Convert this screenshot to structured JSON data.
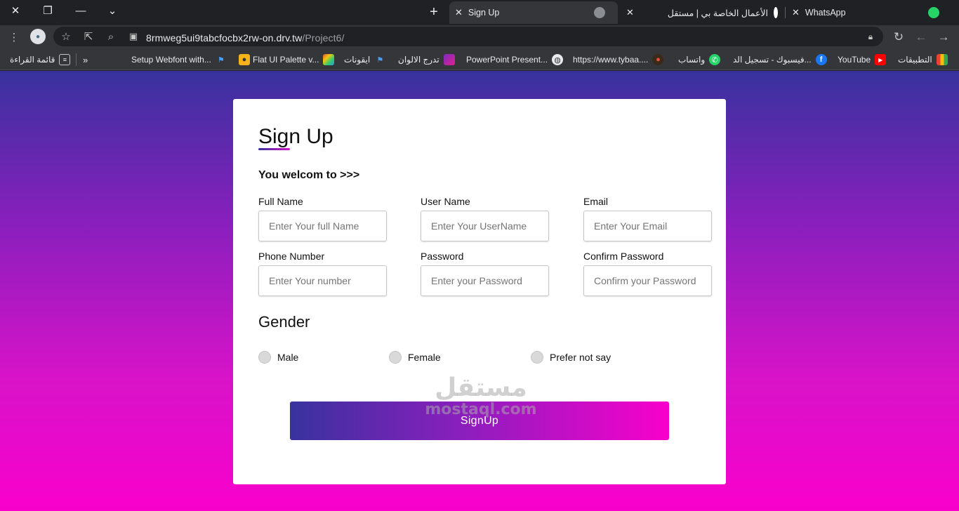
{
  "browser": {
    "tabs": [
      {
        "title": "Sign Up",
        "active": true
      },
      {
        "title": "الأعمال الخاصة بي | مستقل",
        "active": false
      },
      {
        "title": "WhatsApp",
        "active": false
      }
    ],
    "url_host": "8rmweg5ui9tabcfocbx2rw-on.drv.tw",
    "url_path": "/Project6/",
    "reading_list": "قائمة القراءة",
    "bookmarks": [
      {
        "label": "Setup Webfont with...",
        "icon": "flag-icon"
      },
      {
        "label": "Flat UI Palette v...",
        "icon": "palette-icon"
      },
      {
        "label": "ايقونات",
        "icon": "flag-icon"
      },
      {
        "label": "تدرج الالوان",
        "icon": "gradient-icon"
      },
      {
        "label": "PowerPoint Present...",
        "icon": "globe-icon"
      },
      {
        "label": "https://www.tybaa....",
        "icon": "site-icon"
      },
      {
        "label": "واتساب",
        "icon": "whatsapp-icon"
      },
      {
        "label": "فيسبوك - تسجيل الد...",
        "icon": "facebook-icon"
      },
      {
        "label": "YouTube",
        "icon": "youtube-icon"
      },
      {
        "label": "التطبيقات",
        "icon": "apps-grid-icon"
      }
    ]
  },
  "form": {
    "title": "Sign Up",
    "subtitle": "You welcom to >>>",
    "fields": [
      {
        "label": "Full Name",
        "placeholder": "Enter Your full Name"
      },
      {
        "label": "User Name",
        "placeholder": "Enter Your UserName"
      },
      {
        "label": "Email",
        "placeholder": "Enter Your Email"
      },
      {
        "label": "Phone Number",
        "placeholder": "Enter Your number"
      },
      {
        "label": "Password",
        "placeholder": "Enter your Password"
      },
      {
        "label": "Confirm Password",
        "placeholder": "Confirm your Password"
      }
    ],
    "gender_title": "Gender",
    "gender_options": [
      "Male",
      "Female",
      "Prefer not say"
    ],
    "submit_label": "SignUp"
  },
  "watermark": {
    "arabic": "مستقل",
    "latin": "mostaql.com"
  },
  "colors": {
    "gradient_start": "#38329e",
    "gradient_mid": "#8a1fbd",
    "gradient_end": "#f900cc"
  }
}
